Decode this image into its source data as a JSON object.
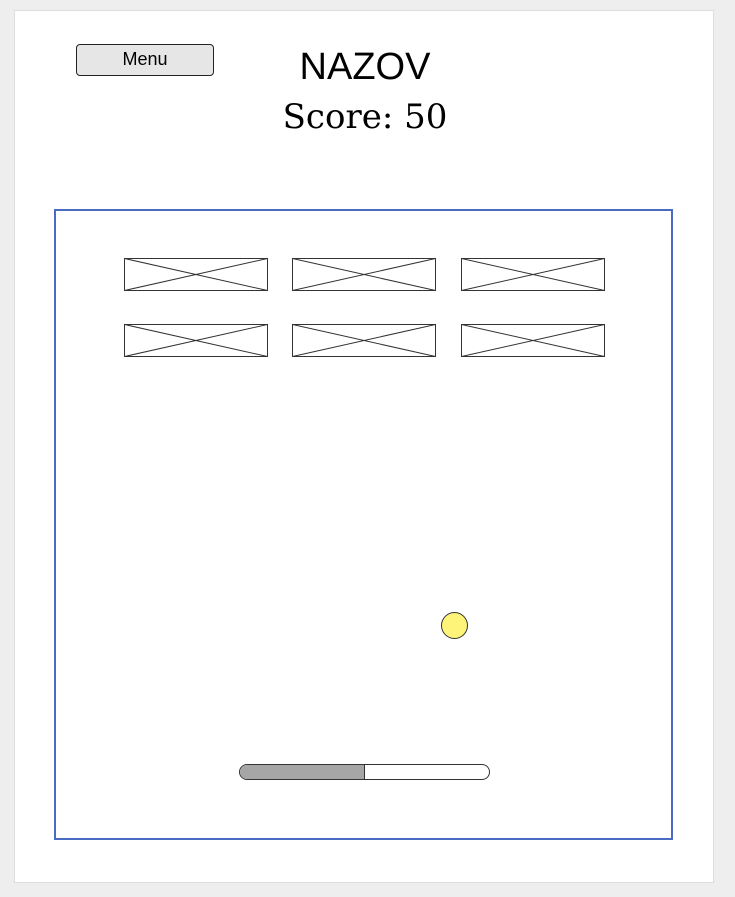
{
  "menu": {
    "label": "Menu"
  },
  "header": {
    "title": "NAZOV",
    "score_label": "Score:",
    "score_value": "50"
  },
  "board": {
    "border_color": "#4a6bc4",
    "bricks": [
      {
        "name": "brick-placeholder",
        "row": 1,
        "col": 1
      },
      {
        "name": "brick-placeholder",
        "row": 1,
        "col": 2
      },
      {
        "name": "brick-placeholder",
        "row": 1,
        "col": 3
      },
      {
        "name": "brick-placeholder",
        "row": 2,
        "col": 1
      },
      {
        "name": "brick-placeholder",
        "row": 2,
        "col": 2
      },
      {
        "name": "brick-placeholder",
        "row": 2,
        "col": 3
      }
    ],
    "ball": {
      "color": "#fff47a"
    },
    "paddle": {
      "fill_fraction": 0.5,
      "fill_color": "#a6a6a6"
    }
  }
}
